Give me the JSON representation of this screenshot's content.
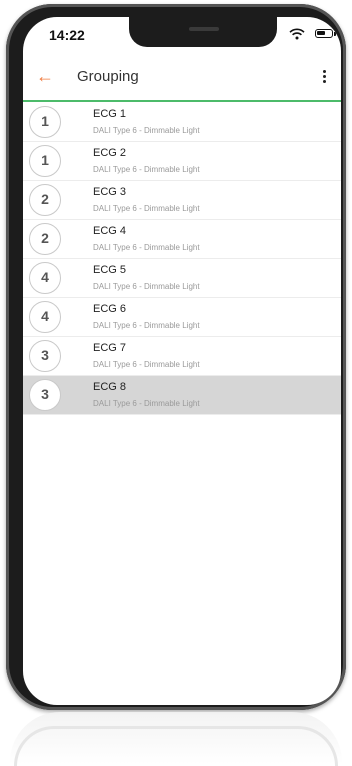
{
  "status_bar": {
    "time": "14:22"
  },
  "app_bar": {
    "title": "Grouping",
    "back_icon": "arrow-left-icon",
    "menu_icon": "more-vertical-icon"
  },
  "colors": {
    "accent": "#f07b3f",
    "divider": "#4cbb6a",
    "selected_row": "#d6d6d6"
  },
  "devices": [
    {
      "group": "1",
      "name": "ECG 1",
      "type": "DALI Type 6 - Dimmable Light"
    },
    {
      "group": "1",
      "name": "ECG 2",
      "type": "DALI Type 6 - Dimmable Light"
    },
    {
      "group": "2",
      "name": "ECG 3",
      "type": "DALI Type 6 - Dimmable Light"
    },
    {
      "group": "2",
      "name": "ECG 4",
      "type": "DALI Type 6 - Dimmable Light"
    },
    {
      "group": "4",
      "name": "ECG 5",
      "type": "DALI Type 6 - Dimmable Light"
    },
    {
      "group": "4",
      "name": "ECG 6",
      "type": "DALI Type 6 - Dimmable Light"
    },
    {
      "group": "3",
      "name": "ECG 7",
      "type": "DALI Type 6 - Dimmable Light"
    },
    {
      "group": "3",
      "name": "ECG 8",
      "type": "DALI Type 6 - Dimmable Light"
    }
  ],
  "selected_device": "ECG 8"
}
